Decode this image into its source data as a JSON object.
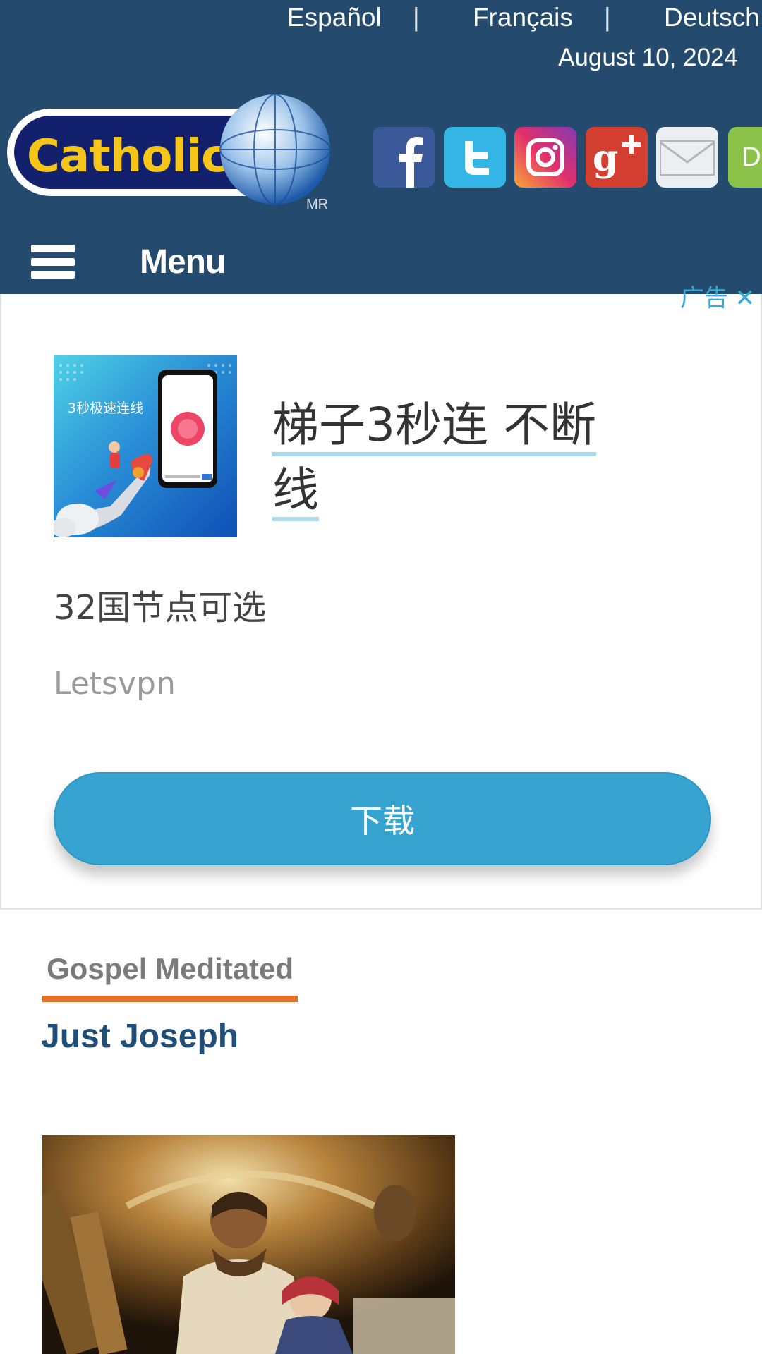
{
  "header": {
    "languages": [
      "Español",
      "Français",
      "Deutsch"
    ],
    "separator": "|",
    "date": "August 10, 2024",
    "logo": {
      "text": "Catholic.net",
      "mark": "MR",
      "icon": "globe-icon"
    },
    "social": [
      {
        "name": "facebook",
        "icon": "facebook-icon",
        "color": "#3b5998"
      },
      {
        "name": "twitter",
        "icon": "twitter-icon",
        "color": "#33b5e5"
      },
      {
        "name": "instagram",
        "icon": "instagram-icon",
        "color": "#c13584"
      },
      {
        "name": "google-plus",
        "icon": "google-plus-icon",
        "color": "#d23f31"
      },
      {
        "name": "email",
        "icon": "mail-icon",
        "color": "#eceff1"
      },
      {
        "name": "partial",
        "icon": "d-icon",
        "color": "#8bc34a",
        "letter": "D"
      }
    ],
    "menu_label": "Menu"
  },
  "ad": {
    "choices_label": "广告",
    "image_caption": "3秒极速连线",
    "title": "梯子3秒连 不断线",
    "description": "32国节点可选",
    "brand": "Letsvpn",
    "cta": "下载"
  },
  "article": {
    "section": "Gospel Meditated",
    "title": "Just Joseph"
  },
  "colors": {
    "header_bg": "#244a6e",
    "cta_bg": "#37a3d0",
    "section_underline": "#e0702a",
    "title_color": "#1f4e78"
  }
}
